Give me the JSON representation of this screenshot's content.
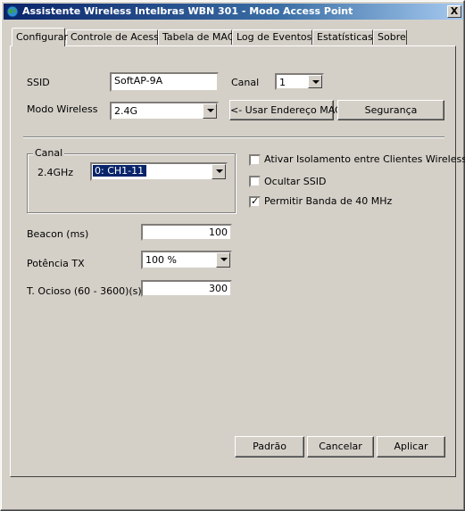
{
  "window": {
    "title": "Assistente Wireless Intelbras WBN 301 - Modo Access Point",
    "close_label": "X"
  },
  "tabs": [
    "Configurar",
    "Controle de Acesso",
    "Tabela de MAC",
    "Log de Eventos",
    "Estatísticas",
    "Sobre"
  ],
  "form": {
    "ssid_label": "SSID",
    "ssid_value": "SoftAP-9A",
    "canal_label": "Canal",
    "canal_value": "1",
    "modo_label": "Modo Wireless",
    "modo_value": "2.4G",
    "usar_mac_button": "<- Usar Endereço MAC",
    "seguranca_button": "Segurança"
  },
  "canal_group": {
    "title": "Canal",
    "band_label": "2.4GHz",
    "channel_value": "0: CH1-11"
  },
  "options": [
    {
      "label": "Ativar Isolamento entre Clientes Wireless",
      "checked": false
    },
    {
      "label": "Ocultar SSID",
      "checked": false
    },
    {
      "label": "Permitir Banda de 40 MHz",
      "checked": true
    }
  ],
  "advanced": {
    "beacon_label": "Beacon (ms)",
    "beacon_value": "100",
    "potencia_label": "Potência TX",
    "potencia_value": "100 %",
    "ocioso_label": "T. Ocioso (60 - 3600)(s)",
    "ocioso_value": "300"
  },
  "footer": {
    "padrao": "Padrão",
    "cancelar": "Cancelar",
    "aplicar": "Aplicar"
  }
}
